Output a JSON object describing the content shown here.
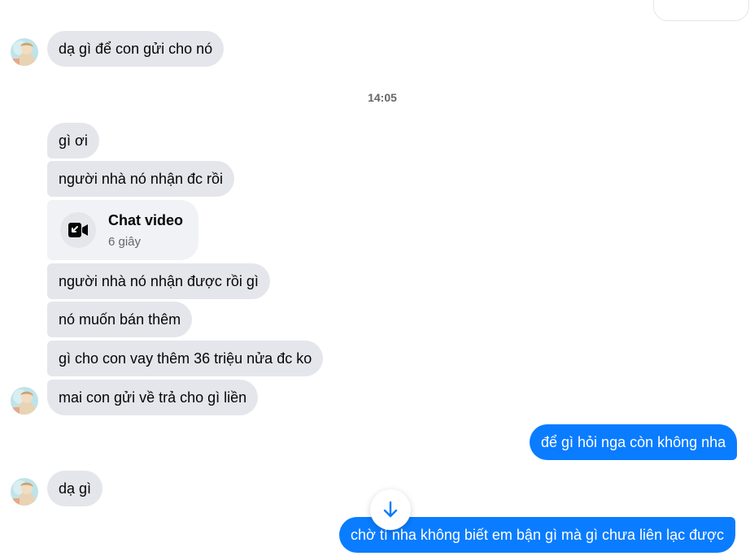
{
  "conversation": {
    "timestamp": "14:05",
    "messages": [
      {
        "text": "dạ gì để con gửi cho nó"
      },
      {
        "text": "gì ơi"
      },
      {
        "text": "người nhà nó nhận đc rồi"
      },
      {
        "text": "người nhà nó nhận được rồi gì"
      },
      {
        "text": "nó muốn bán thêm"
      },
      {
        "text": "gì cho con vay thêm 36 triệu nửa đc ko"
      },
      {
        "text": "mai con gửi về trả cho gì liền"
      },
      {
        "text": "để gì hỏi nga còn không nha"
      },
      {
        "text": "dạ gì"
      },
      {
        "text": "chờ tí nha không biết em bận gì mà gì chưa liên lạc được"
      }
    ],
    "call": {
      "title": "Chat video",
      "duration": "6 giây",
      "icon": "video-call-icon"
    }
  },
  "colors": {
    "incoming_bubble": "#e4e6eb",
    "outgoing_bubble": "#0a7cff",
    "accent": "#0a7cff"
  },
  "icons": {
    "scroll_down": "arrow-down-icon",
    "avatar": "avatar"
  }
}
